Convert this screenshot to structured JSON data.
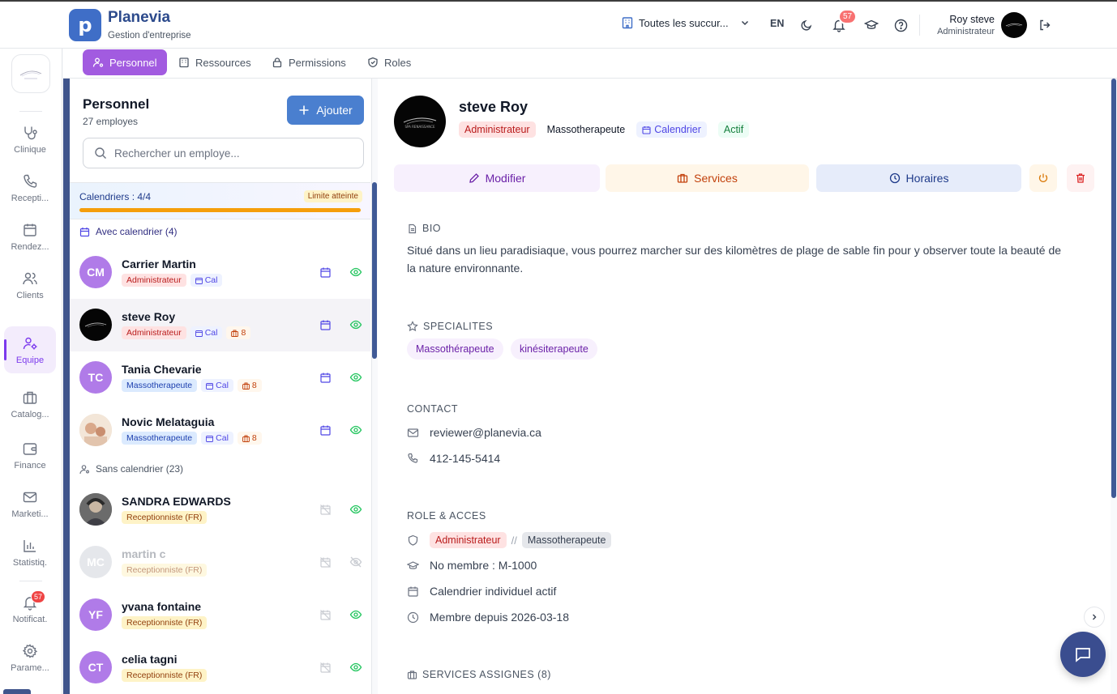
{
  "app": {
    "logo_letter": "p",
    "name": "Planevia",
    "subtitle": "Gestion d'entreprise"
  },
  "topbar": {
    "branch_label": "Toutes les succur...",
    "language": "EN",
    "notification_count": "57",
    "user_name": "Roy steve",
    "user_role": "Administrateur"
  },
  "sidebar": {
    "items": [
      {
        "label": "Clinique",
        "icon": "stethoscope-icon"
      },
      {
        "label": "Recepti...",
        "icon": "phone-icon"
      },
      {
        "label": "Rendez...",
        "icon": "calendar-icon"
      },
      {
        "label": "Clients",
        "icon": "users-icon"
      },
      {
        "label": "Equipe",
        "icon": "user-cog-icon"
      },
      {
        "label": "Catalog...",
        "icon": "briefcase-icon"
      },
      {
        "label": "Finance",
        "icon": "wallet-icon"
      },
      {
        "label": "Marketi...",
        "icon": "mail-icon"
      },
      {
        "label": "Statistiq.",
        "icon": "bar-chart-icon"
      },
      {
        "label": "Notificat.",
        "icon": "bell-icon",
        "badge": "57"
      },
      {
        "label": "Parame...",
        "icon": "gear-icon"
      }
    ]
  },
  "tabs": [
    {
      "label": "Personnel",
      "active": true
    },
    {
      "label": "Ressources"
    },
    {
      "label": "Permissions"
    },
    {
      "label": "Roles"
    }
  ],
  "personnel": {
    "title": "Personnel",
    "count_label": "27 employes",
    "add_label": "Ajouter",
    "search_placeholder": "Rechercher un employe...",
    "calendars_label": "Calendriers : 4/4",
    "calendars_used": 4,
    "calendars_total": 4,
    "limit_label": "Limite atteinte",
    "with_calendar_label": "Avec calendrier (4)",
    "without_calendar_label": "Sans calendrier (23)",
    "employees": [
      {
        "initials": "CM",
        "name": "Carrier Martin",
        "role": "Administrateur",
        "role_type": "admin",
        "cal": "Cal",
        "services": "",
        "color": "#b07be8",
        "has_calendar": true,
        "visible": true
      },
      {
        "initials": "",
        "name": "steve Roy",
        "role": "Administrateur",
        "role_type": "admin",
        "cal": "Cal",
        "services": "8",
        "color": "#050505",
        "has_calendar": true,
        "visible": true,
        "selected": true
      },
      {
        "initials": "TC",
        "name": "Tania Chevarie",
        "role": "Massotherapeute",
        "role_type": "masso",
        "cal": "Cal",
        "services": "8",
        "color": "#b07be8",
        "has_calendar": true,
        "visible": true
      },
      {
        "initials": "",
        "name": "Novic Melataguia",
        "role": "Massotherapeute",
        "role_type": "masso",
        "cal": "Cal",
        "services": "8",
        "color": "#e8d5c4",
        "has_calendar": true,
        "visible": true
      },
      {
        "initials": "",
        "name": "SANDRA EDWARDS",
        "role": "Receptionniste (FR)",
        "role_type": "recep",
        "cal": "",
        "services": "",
        "color": "#5b5b5b",
        "has_calendar": false,
        "visible": true
      },
      {
        "initials": "MC",
        "name": "martin c",
        "role": "Receptionniste (FR)",
        "role_type": "recep",
        "cal": "",
        "services": "",
        "color": "#e5e7eb",
        "has_calendar": false,
        "visible": false,
        "dim": true
      },
      {
        "initials": "YF",
        "name": "yvana fontaine",
        "role": "Receptionniste (FR)",
        "role_type": "recep",
        "cal": "",
        "services": "",
        "color": "#b07be8",
        "has_calendar": false,
        "visible": true
      },
      {
        "initials": "CT",
        "name": "celia tagni",
        "role": "Receptionniste (FR)",
        "role_type": "recep",
        "cal": "",
        "services": "",
        "color": "#b07be8",
        "has_calendar": false,
        "visible": true
      }
    ]
  },
  "detail": {
    "name": "steve Roy",
    "role": "Administrateur",
    "specialty": "Massotherapeute",
    "calendar_tag": "Calendrier",
    "status": "Actif",
    "actions": {
      "edit": "Modifier",
      "services": "Services",
      "schedule": "Horaires"
    },
    "bio_title": "BIO",
    "bio": "Situé dans un lieu paradisiaque, vous pourrez marcher sur des kilomètres de plage de sable fin pour y observer toute la beauté de la nature environnante.",
    "specialties_title": "SPECIALITES",
    "specialties": [
      "Massothérapeute",
      "kinésiterapeute"
    ],
    "contact_title": "CONTACT",
    "email": "reviewer@planevia.ca",
    "phone": "412-145-5414",
    "access_title": "ROLE & ACCES",
    "access_role": "Administrateur",
    "access_separator": "//",
    "access_specialty": "Massotherapeute",
    "member_no": "No membre : M-1000",
    "calendar_status": "Calendrier individuel actif",
    "member_since": "Membre depuis 2026-03-18",
    "services_title": "SERVICES ASSIGNES (8)"
  },
  "colors": {
    "accent": "#a25be0",
    "primary": "#4a7fcf",
    "navy": "#40558c"
  }
}
